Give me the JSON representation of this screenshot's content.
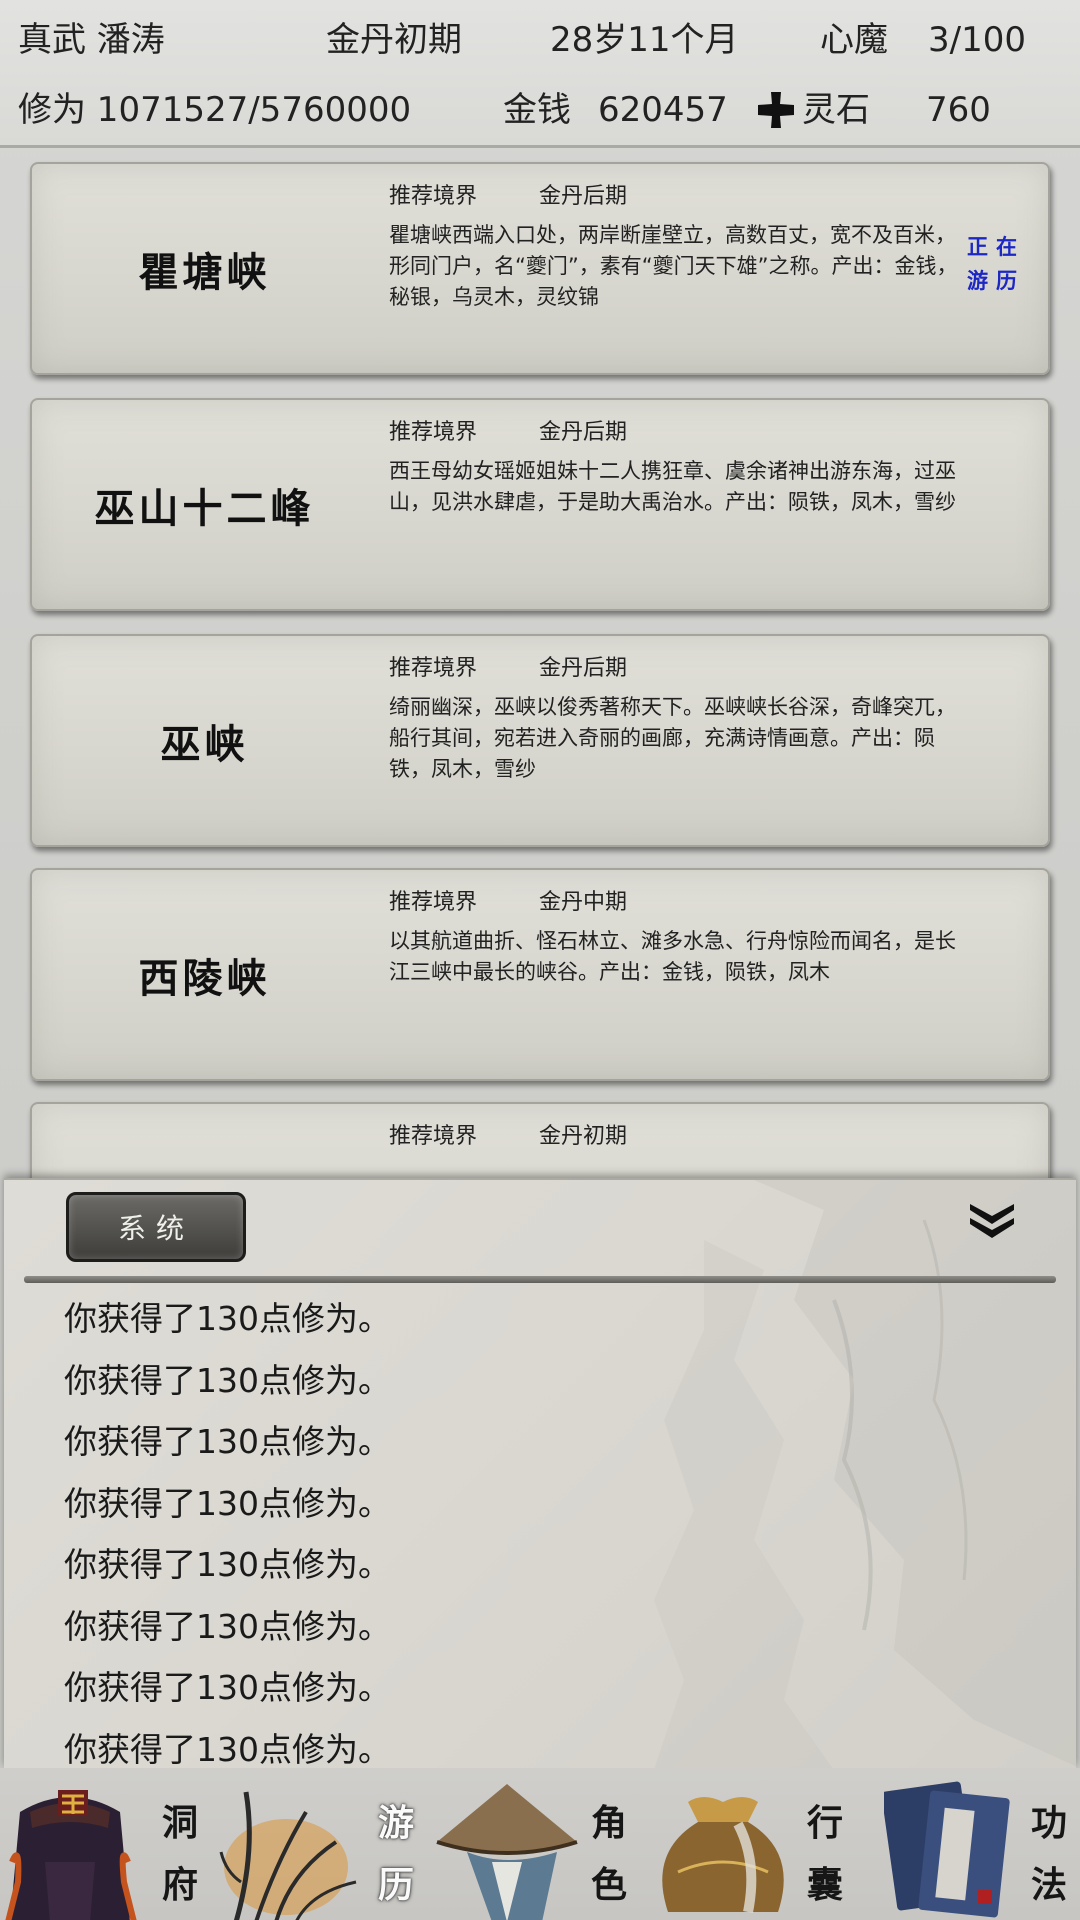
{
  "status": {
    "character": "真武 潘涛",
    "realm": "金丹初期",
    "age": "28岁11个月",
    "demon_label": "心魔",
    "demon_value": "3/100",
    "cultivation": "修为 1071527/5760000",
    "money_label": "金钱",
    "money_value": "620457",
    "spirit_stone_label": "灵石",
    "spirit_stone_value": "760",
    "spirit_stone_icon": "cross-icon"
  },
  "locations": [
    {
      "name": "瞿塘峡",
      "realm_label": "推荐境界",
      "realm": "金丹后期",
      "description": "瞿塘峡西端入口处，两岸断崖壁立，高数百丈，宽不及百米，形同门户，名“夔门”，素有“夔门天下雄”之称。产出：金钱，秘银，乌灵木，灵纹锦",
      "status": "正在游历"
    },
    {
      "name": "巫山十二峰",
      "realm_label": "推荐境界",
      "realm": "金丹后期",
      "description": "西王母幼女瑶姬姐妹十二人携狂章、虞余诸神出游东海，过巫山，见洪水肆虐，于是助大禹治水。产出：陨铁，凤木，雪纱",
      "status": ""
    },
    {
      "name": "巫峡",
      "realm_label": "推荐境界",
      "realm": "金丹后期",
      "description": "绮丽幽深，巫峡以俊秀著称天下。巫峡峡长谷深，奇峰突兀，船行其间，宛若进入奇丽的画廊，充满诗情画意。产出：陨铁，凤木，雪纱",
      "status": ""
    },
    {
      "name": "西陵峡",
      "realm_label": "推荐境界",
      "realm": "金丹中期",
      "description": "以其航道曲折、怪石林立、滩多水急、行舟惊险而闻名，是长江三峡中最长的峡谷。产出：金钱，陨铁，凤木",
      "status": ""
    },
    {
      "name": "",
      "realm_label": "推荐境界",
      "realm": "金丹初期",
      "description": "",
      "status": ""
    }
  ],
  "log": {
    "tab_label": "系统",
    "collapse_icon": "double-chevron-down-icon",
    "lines": [
      "你获得了130点修为。",
      "你获得了130点修为。",
      "你获得了130点修为。",
      "你获得了130点修为。",
      "你获得了130点修为。",
      "你获得了130点修为。",
      "你获得了130点修为。",
      "你获得了130点修为。"
    ]
  },
  "nav": [
    {
      "label": "洞府",
      "icon": "cave-dwelling-icon",
      "active": false
    },
    {
      "label": "游历",
      "icon": "travel-reeds-icon",
      "active": true
    },
    {
      "label": "角色",
      "icon": "bamboo-hat-icon",
      "active": false
    },
    {
      "label": "行囊",
      "icon": "bag-icon",
      "active": false
    },
    {
      "label": "功法",
      "icon": "scripture-books-icon",
      "active": false
    }
  ]
}
